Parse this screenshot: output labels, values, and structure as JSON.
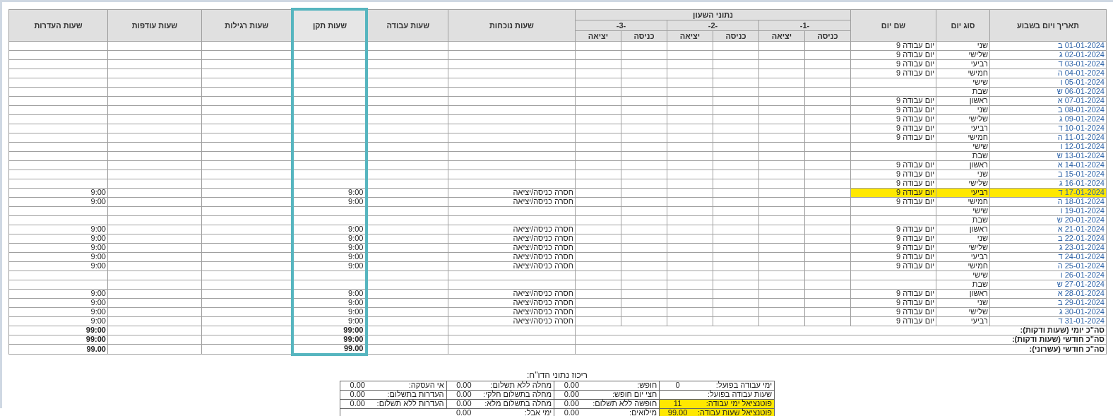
{
  "table": {
    "columns": [
      {
        "label": "תאריך ויום בשבוע",
        "highlighted": false
      },
      {
        "label": "סוג יום",
        "highlighted": false
      },
      {
        "label": "שם יום",
        "highlighted": false
      },
      {
        "label": "שעות נוכחות",
        "highlighted": false
      },
      {
        "label": "שעות עבודה",
        "highlighted": false
      },
      {
        "label": "שעות תקן",
        "highlighted": true
      },
      {
        "label": "שעות רגילות",
        "highlighted": false
      },
      {
        "label": "שעות עודפות",
        "highlighted": false
      },
      {
        "label": "שעות העדרות",
        "highlighted": false
      }
    ],
    "clock_group": {
      "label": "נתוני השעון",
      "groups": [
        {
          "label": "-1-",
          "columns": [
            "כניסה",
            "יציאה"
          ]
        },
        {
          "label": "-2-",
          "columns": [
            "כניסה",
            "יציאה"
          ]
        },
        {
          "label": "-3-",
          "columns": [
            "כניסה",
            "יציאה"
          ]
        }
      ]
    },
    "rows": [
      {
        "date": "01-01-2024 ב",
        "day": "שני",
        "type": "יום עבודה 9",
        "highlighted": false
      },
      {
        "date": "02-01-2024 ג",
        "day": "שלישי",
        "type": "יום עבודה 9",
        "highlighted": false
      },
      {
        "date": "03-01-2024 ד",
        "day": "רביעי",
        "type": "יום עבודה 9",
        "highlighted": false
      },
      {
        "date": "04-01-2024 ה",
        "day": "חמישי",
        "type": "יום עבודה 9",
        "highlighted": false
      },
      {
        "date": "05-01-2024 ו",
        "day": "שישי",
        "highlighted": false
      },
      {
        "date": "06-01-2024 ש",
        "day": "שבת",
        "highlighted": false
      },
      {
        "date": "07-01-2024 א",
        "day": "ראשון",
        "type": "יום עבודה 9",
        "highlighted": false
      },
      {
        "date": "08-01-2024 ב",
        "day": "שני",
        "type": "יום עבודה 9",
        "highlighted": false
      },
      {
        "date": "09-01-2024 ג",
        "day": "שלישי",
        "type": "יום עבודה 9",
        "highlighted": false
      },
      {
        "date": "10-01-2024 ד",
        "day": "רביעי",
        "type": "יום עבודה 9",
        "highlighted": false
      },
      {
        "date": "11-01-2024 ה",
        "day": "חמישי",
        "type": "יום עבודה 9",
        "highlighted": false
      },
      {
        "date": "12-01-2024 ו",
        "day": "שישי",
        "highlighted": false
      },
      {
        "date": "13-01-2024 ש",
        "day": "שבת",
        "highlighted": false
      },
      {
        "date": "14-01-2024 א",
        "day": "ראשון",
        "type": "יום עבודה 9",
        "highlighted": false
      },
      {
        "date": "15-01-2024 ב",
        "day": "שני",
        "type": "יום עבודה 9",
        "highlighted": false
      },
      {
        "date": "16-01-2024 ג",
        "day": "שלישי",
        "type": "יום עבודה 9",
        "highlighted": false
      },
      {
        "date": "17-01-2024 ד",
        "day": "רביעי",
        "type": "יום עבודה 9",
        "presence": "חסרה כניסה/יציאה",
        "standard": "9:00",
        "absence": "9:00",
        "highlighted": true
      },
      {
        "date": "18-01-2024 ה",
        "day": "חמישי",
        "type": "יום עבודה 9",
        "presence": "חסרה כניסה/יציאה",
        "standard": "9:00",
        "absence": "9:00",
        "highlighted": false
      },
      {
        "date": "19-01-2024 ו",
        "day": "שישי",
        "highlighted": false
      },
      {
        "date": "20-01-2024 ש",
        "day": "שבת",
        "highlighted": false
      },
      {
        "date": "21-01-2024 א",
        "day": "ראשון",
        "type": "יום עבודה 9",
        "presence": "חסרה כניסה/יציאה",
        "standard": "9:00",
        "absence": "9:00",
        "highlighted": false
      },
      {
        "date": "22-01-2024 ב",
        "day": "שני",
        "type": "יום עבודה 9",
        "presence": "חסרה כניסה/יציאה",
        "standard": "9:00",
        "absence": "9:00",
        "highlighted": false
      },
      {
        "date": "23-01-2024 ג",
        "day": "שלישי",
        "type": "יום עבודה 9",
        "presence": "חסרה כניסה/יציאה",
        "standard": "9:00",
        "absence": "9:00",
        "highlighted": false
      },
      {
        "date": "24-01-2024 ד",
        "day": "רביעי",
        "type": "יום עבודה 9",
        "presence": "חסרה כניסה/יציאה",
        "standard": "9:00",
        "absence": "9:00",
        "highlighted": false
      },
      {
        "date": "25-01-2024 ה",
        "day": "חמישי",
        "type": "יום עבודה 9",
        "presence": "חסרה כניסה/יציאה",
        "standard": "9:00",
        "absence": "9:00",
        "highlighted": false
      },
      {
        "date": "26-01-2024 ו",
        "day": "שישי",
        "highlighted": false
      },
      {
        "date": "27-01-2024 ש",
        "day": "שבת",
        "highlighted": false
      },
      {
        "date": "28-01-2024 א",
        "day": "ראשון",
        "type": "יום עבודה 9",
        "presence": "חסרה כניסה/יציאה",
        "standard": "9:00",
        "absence": "9:00",
        "highlighted": false
      },
      {
        "date": "29-01-2024 ב",
        "day": "שני",
        "type": "יום עבודה 9",
        "presence": "חסרה כניסה/יציאה",
        "standard": "9:00",
        "absence": "9:00",
        "highlighted": false
      },
      {
        "date": "30-01-2024 ג",
        "day": "שלישי",
        "type": "יום עבודה 9",
        "presence": "חסרה כניסה/יציאה",
        "standard": "9:00",
        "absence": "9:00",
        "highlighted": false
      },
      {
        "date": "31-01-2024 ד",
        "day": "רביעי",
        "type": "יום עבודה 9",
        "presence": "חסרה כניסה/יציאה",
        "standard": "9:00",
        "absence": "9:00",
        "highlighted": false
      }
    ],
    "totals": [
      {
        "label": "סה\"כ יומי (שעות ודקות):",
        "standard": "99:00",
        "absence": "99:00"
      },
      {
        "label": "סה\"כ חודשי (שעות ודקות):",
        "standard": "99:00",
        "absence": "99:00"
      },
      {
        "label": "סה\"כ חודשי (עשרוני):",
        "standard": "99.00",
        "absence": "99.00"
      }
    ]
  },
  "summary": {
    "title": "ריכוז נתוני הדו\"ח:",
    "rows": [
      {
        "cells": [
          {
            "label": "ימי עבודה בפועל:",
            "value": "0"
          },
          {
            "label": "חופש:",
            "value": "0.00"
          },
          {
            "label": "מחלה ללא תשלום:",
            "value": "0.00"
          },
          {
            "label": "אי העסקה:",
            "value": "0.00"
          }
        ],
        "highlighted": false
      },
      {
        "cells": [
          {
            "label": "שעות עבודה בפועל:"
          },
          {
            "label": "חצי יום חופש:",
            "value": "0.00"
          },
          {
            "label": "מחלה בתשלום חלקי:",
            "value": "0.00"
          },
          {
            "label": "העדרות בתשלום:",
            "value": "0.00"
          }
        ],
        "highlighted": false
      },
      {
        "cells": [
          {
            "label": "פוטנציאל ימי עבודה:",
            "value": "11"
          },
          {
            "label": "חופשה ללא תשלום:",
            "value": "0.00"
          },
          {
            "label": "מחלה בתשלום מלא:",
            "value": "0.00"
          },
          {
            "label": "העדרות ללא תשלום:",
            "value": "0.00"
          }
        ],
        "highlighted": true
      },
      {
        "cells": [
          {
            "label": "פוטנציאל שעות עבודה:",
            "value": "99.00"
          },
          {
            "label": "מילואים:",
            "value": "0.00"
          },
          {
            "label": "ימי אבל:",
            "value": "0.00"
          }
        ],
        "highlighted": true
      }
    ]
  }
}
